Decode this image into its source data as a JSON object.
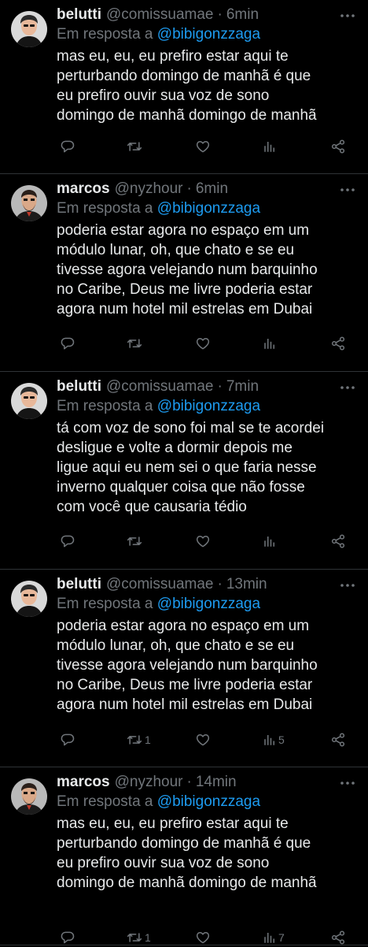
{
  "tweets": [
    {
      "name": "belutti",
      "handle": "@comissuamae",
      "separator": "·",
      "time": "6min",
      "replying_prefix": "Em resposta a ",
      "replying_to": "@bibigonzzaga",
      "lines": [
        "mas eu, eu, eu prefiro estar aqui te",
        "perturbando domingo de manhã é que",
        "eu prefiro ouvir sua voz de sono",
        "domingo de manhã domingo de manhã"
      ],
      "retweets": "",
      "views": "",
      "avatar": "belutti"
    },
    {
      "name": "marcos",
      "handle": "@nyzhour",
      "separator": "·",
      "time": "6min",
      "replying_prefix": "Em resposta a ",
      "replying_to": "@bibigonzzaga",
      "lines": [
        "poderia estar agora no espaço em um",
        "módulo lunar, oh, que chato e se eu",
        "tivesse agora velejando num barquinho",
        "no Caribe, Deus me livre poderia estar",
        "agora num hotel mil estrelas em Dubai"
      ],
      "retweets": "",
      "views": "",
      "avatar": "marcos"
    },
    {
      "name": "belutti",
      "handle": "@comissuamae",
      "separator": "·",
      "time": "7min",
      "replying_prefix": "Em resposta a ",
      "replying_to": "@bibigonzzaga",
      "lines": [
        "tá com voz de sono foi mal se te acordei",
        "desligue e volte a dormir depois me",
        "ligue aqui eu nem sei o que faria nesse",
        "inverno qualquer coisa que não fosse",
        "com você que causaria tédio"
      ],
      "retweets": "",
      "views": "",
      "avatar": "belutti"
    },
    {
      "name": "belutti",
      "handle": "@comissuamae",
      "separator": "·",
      "time": "13min",
      "replying_prefix": "Em resposta a ",
      "replying_to": "@bibigonzzaga",
      "lines": [
        "poderia estar agora no espaço em um",
        "módulo lunar, oh, que chato e se eu",
        "tivesse agora velejando num barquinho",
        "no Caribe, Deus me livre poderia estar",
        "agora num hotel mil estrelas em Dubai"
      ],
      "retweets": "1",
      "views": "5",
      "avatar": "belutti"
    },
    {
      "name": "marcos",
      "handle": "@nyzhour",
      "separator": "·",
      "time": "14min",
      "replying_prefix": "Em resposta a ",
      "replying_to": "@bibigonzzaga",
      "lines": [
        "mas eu, eu, eu prefiro estar aqui te",
        "perturbando domingo de manhã é que",
        "eu prefiro ouvir sua voz de sono",
        "domingo de manhã domingo de manhã"
      ],
      "retweets": "1",
      "views": "7",
      "avatar": "marcos"
    }
  ],
  "icons": {
    "reply": "reply-icon",
    "retweet": "retweet-icon",
    "like": "heart-icon",
    "views": "views-icon",
    "share": "share-icon",
    "more": "more-icon"
  },
  "colors": {
    "background": "#000000",
    "text": "#e7e9ea",
    "muted": "#71767b",
    "link": "#1d9bf0",
    "divider": "#2f3336"
  }
}
